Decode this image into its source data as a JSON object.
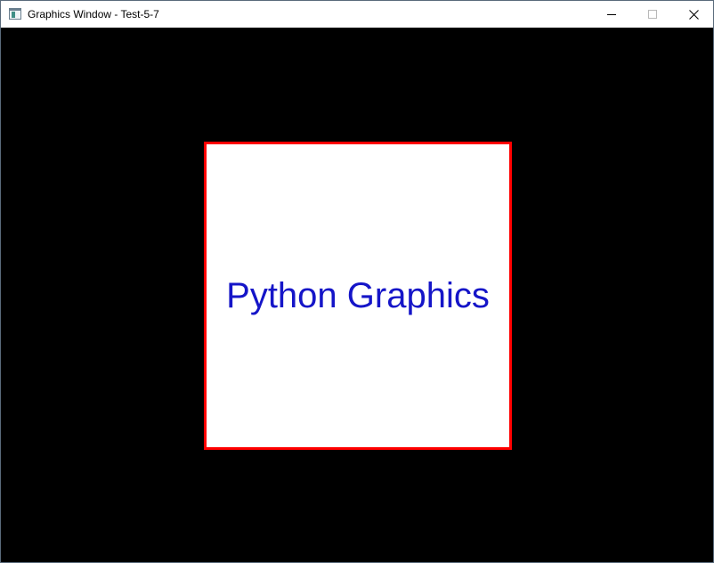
{
  "window": {
    "title": "Graphics Window - Test-5-7",
    "icons": {
      "app": "app-window-icon",
      "minimize": "minimize-icon",
      "maximize": "maximize-icon",
      "close": "close-icon"
    }
  },
  "canvas": {
    "background_color": "#000000",
    "square": {
      "fill_color": "#ffffff",
      "outline_color": "#ff0000"
    },
    "text": {
      "content": "Python Graphics",
      "color": "#1515c8"
    }
  }
}
